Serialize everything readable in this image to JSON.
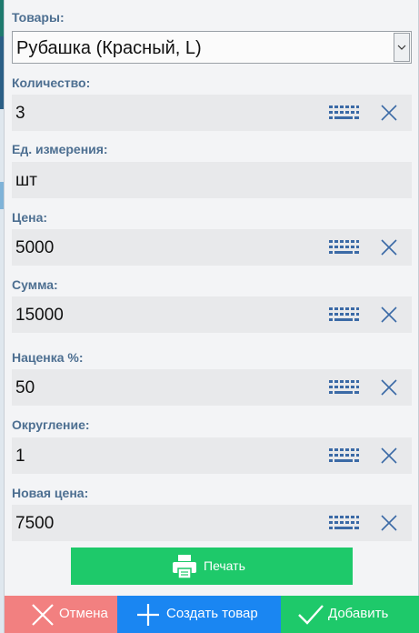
{
  "form": {
    "product": {
      "label": "Товары:",
      "value": "Рубашка (Красный, L)"
    },
    "quantity": {
      "label": "Количество:",
      "value": "3"
    },
    "unit": {
      "label": "Ед. измерения:",
      "value": "шт"
    },
    "price": {
      "label": "Цена:",
      "value": "5000"
    },
    "sum": {
      "label": "Сумма:",
      "value": "15000"
    },
    "markup": {
      "label": "Наценка %:",
      "value": "50"
    },
    "rounding": {
      "label": "Округление:",
      "value": "1"
    },
    "new_price": {
      "label": "Новая цена:",
      "value": "7500"
    }
  },
  "actions": {
    "print_label": "Печать",
    "cancel_label": "Отмена",
    "create_label": "Создать товар",
    "add_label": "Добавить"
  },
  "icons": {
    "keyboard": "keyboard-icon",
    "clear": "close-icon",
    "printer": "printer-icon",
    "cancel": "close-icon",
    "create": "plus-icon",
    "add": "checkmark-icon",
    "dropdown": "chevron-down-icon"
  },
  "colors": {
    "label": "#4d6f91",
    "icon": "#3b6aa6",
    "green": "#1ec96a",
    "blue": "#1a86f2",
    "red": "#f28080"
  }
}
